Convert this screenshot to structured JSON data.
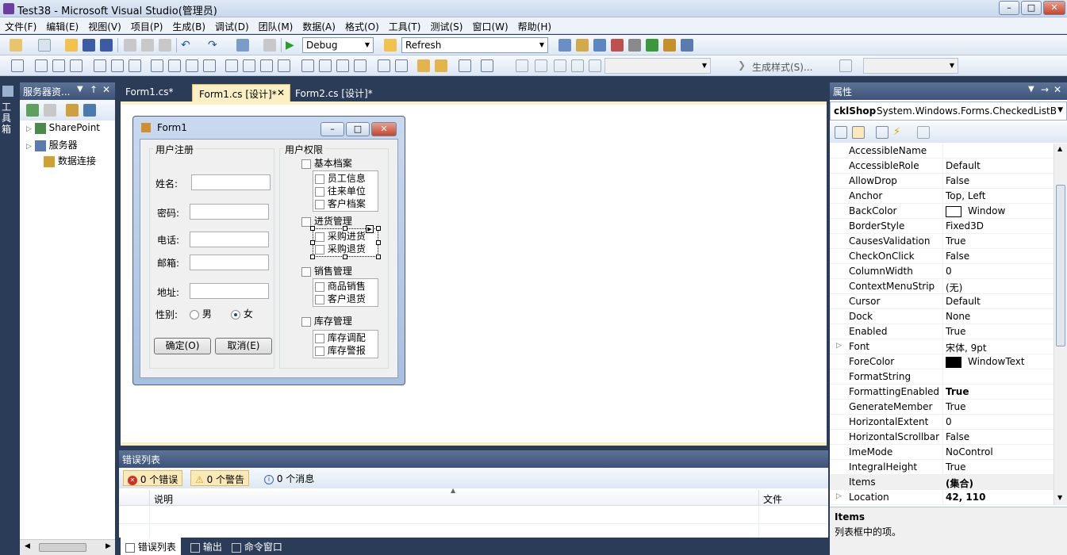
{
  "window": {
    "title": "Test38 - Microsoft Visual Studio(管理员)"
  },
  "menu": [
    "文件(F)",
    "编辑(E)",
    "视图(V)",
    "项目(P)",
    "生成(B)",
    "调试(D)",
    "团队(M)",
    "数据(A)",
    "格式(O)",
    "工具(T)",
    "测试(S)",
    "窗口(W)",
    "帮助(H)"
  ],
  "toolbar": {
    "config": "Debug",
    "target": "Refresh",
    "gen_style": "生成样式(S)..."
  },
  "left_strip": {
    "toolbox": "工具箱"
  },
  "server_panel": {
    "title": "服务器资...",
    "items": [
      "SharePoint",
      "服务器",
      "数据连接"
    ]
  },
  "tabs": [
    {
      "label": "Form1.cs*"
    },
    {
      "label": "Form1.cs [设计]*"
    },
    {
      "label": "Form2.cs [设计]*"
    }
  ],
  "form": {
    "title": "Form1",
    "reg_group": "用户注册",
    "perm_group": "用户权限",
    "labels": {
      "name": "姓名:",
      "pwd": "密码:",
      "phone": "电话:",
      "mail": "邮箱:",
      "addr": "地址:",
      "gender": "性别:"
    },
    "gender_male": "男",
    "gender_female": "女",
    "ok": "确定(O)",
    "cancel": "取消(E)",
    "groups": [
      {
        "name": "基本档案",
        "items": [
          "员工信息",
          "往来单位",
          "客户档案"
        ]
      },
      {
        "name": "进货管理",
        "items": [
          "采购进货",
          "采购退货"
        ]
      },
      {
        "name": "销售管理",
        "items": [
          "商品销售",
          "客户退货"
        ]
      },
      {
        "name": "库存管理",
        "items": [
          "库存调配",
          "库存警报"
        ]
      }
    ]
  },
  "error_list": {
    "title": "错误列表",
    "errors": "0 个错误",
    "warnings": "0 个警告",
    "messages": "0 个消息",
    "col_desc": "说明",
    "col_file": "文件"
  },
  "bottom_tabs": [
    "错误列表",
    "输出",
    "命令窗口"
  ],
  "properties": {
    "title": "属性",
    "object_name": "cklShop",
    "object_type": "System.Windows.Forms.CheckedListBc",
    "rows": [
      {
        "n": "AccessibleName",
        "v": ""
      },
      {
        "n": "AccessibleRole",
        "v": "Default"
      },
      {
        "n": "AllowDrop",
        "v": "False"
      },
      {
        "n": "Anchor",
        "v": "Top, Left"
      },
      {
        "n": "BackColor",
        "v": "Window"
      },
      {
        "n": "BorderStyle",
        "v": "Fixed3D"
      },
      {
        "n": "CausesValidation",
        "v": "True"
      },
      {
        "n": "CheckOnClick",
        "v": "False"
      },
      {
        "n": "ColumnWidth",
        "v": "0"
      },
      {
        "n": "ContextMenuStrip",
        "v": "(无)"
      },
      {
        "n": "Cursor",
        "v": "Default"
      },
      {
        "n": "Dock",
        "v": "None"
      },
      {
        "n": "Enabled",
        "v": "True"
      },
      {
        "n": "Font",
        "v": "宋体, 9pt"
      },
      {
        "n": "ForeColor",
        "v": "WindowText"
      },
      {
        "n": "FormatString",
        "v": ""
      },
      {
        "n": "FormattingEnabled",
        "v": "True"
      },
      {
        "n": "GenerateMember",
        "v": "True"
      },
      {
        "n": "HorizontalExtent",
        "v": "0"
      },
      {
        "n": "HorizontalScrollbar",
        "v": "False"
      },
      {
        "n": "ImeMode",
        "v": "NoControl"
      },
      {
        "n": "IntegralHeight",
        "v": "True"
      },
      {
        "n": "Items",
        "v": "(集合)"
      },
      {
        "n": "Location",
        "v": "42, 110"
      }
    ],
    "desc_title": "Items",
    "desc_text": "列表框中的项。"
  },
  "colors": {
    "bg": "#2b3c59",
    "design_bg": "#ffffff",
    "tab_active": "#fbf0c4"
  }
}
